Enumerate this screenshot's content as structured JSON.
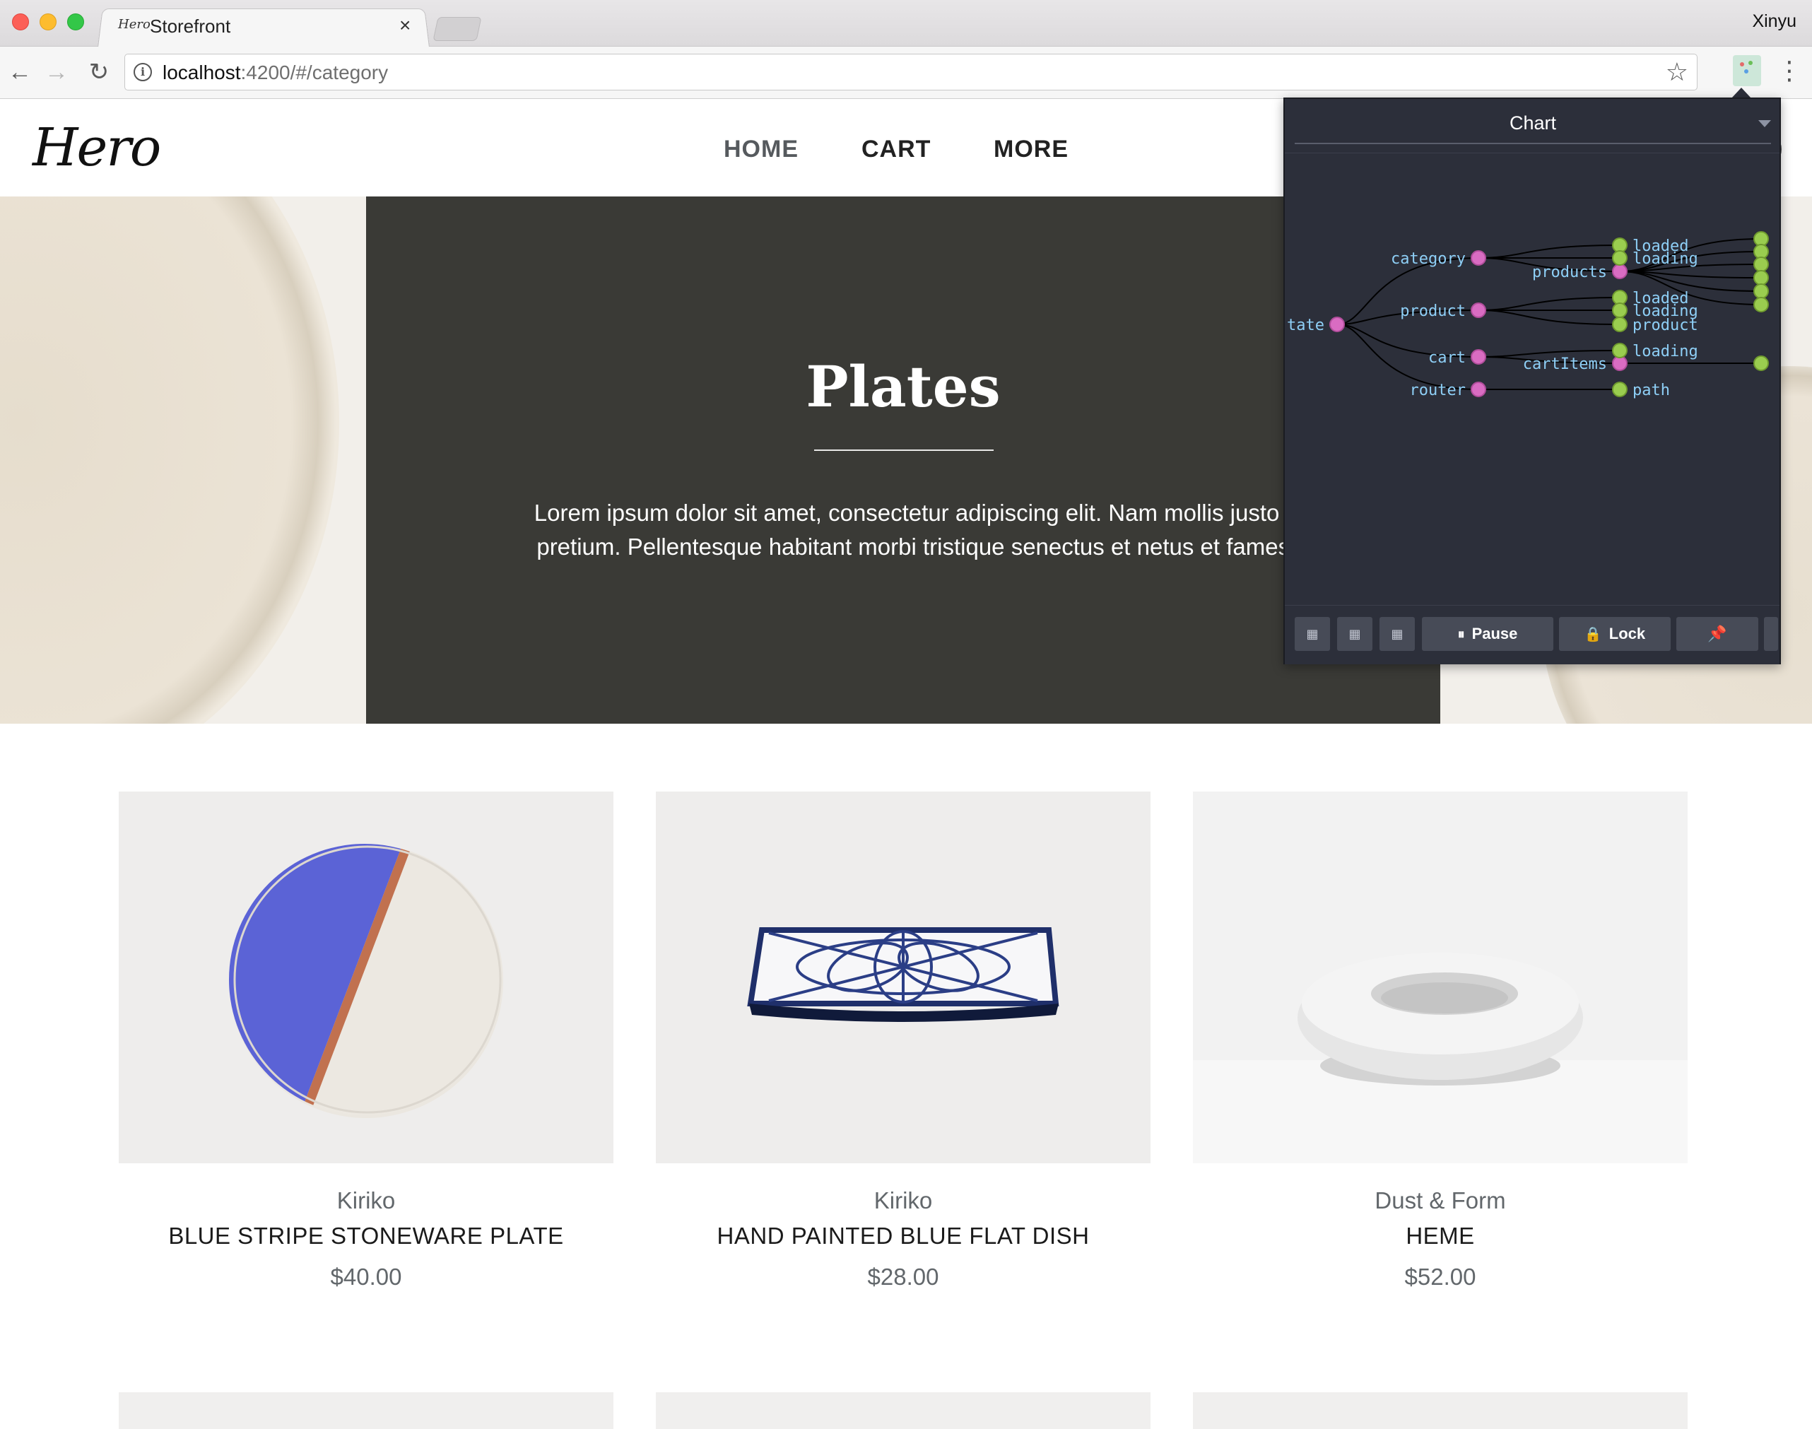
{
  "browser": {
    "tab_title": "Storefront",
    "tab_close_glyph": "×",
    "favicon_text": "Hero",
    "profile_name": "Xinyu",
    "url_host": "localhost",
    "url_path": ":4200/#/category",
    "icons": [
      "back-arrow-icon",
      "forward-arrow-icon",
      "reload-icon",
      "info-icon",
      "star-icon",
      "extension-icon",
      "more-vertical-icon"
    ]
  },
  "site": {
    "logo": "Hero",
    "nav": {
      "home": "HOME",
      "cart": "CART",
      "more": "MORE"
    },
    "header_edge_glyph": ")"
  },
  "hero": {
    "title": "Plates",
    "description_line1": "Lorem ipsum dolor sit amet, consectetur adipiscing elit. Nam mollis justo id cor",
    "description_line2": "pretium. Pellentesque habitant morbi tristique senectus et netus et fames ac e"
  },
  "products": [
    {
      "brand": "Kiriko",
      "name": "BLUE STRIPE STONEWARE PLATE",
      "price": "$40.00"
    },
    {
      "brand": "Kiriko",
      "name": "HAND PAINTED BLUE FLAT DISH",
      "price": "$28.00"
    },
    {
      "brand": "Dust & Form",
      "name": "HEME",
      "price": "$52.00"
    }
  ],
  "devtools": {
    "view_select": "Chart",
    "colors": {
      "branch_node": "#d96cc2",
      "leaf_node": "#9acd4f",
      "label": "#8ecff6",
      "panel_bg": "#2c2f3a"
    },
    "tree_labels": {
      "root": "tate",
      "category": "category",
      "category_loaded": "loaded",
      "category_loading": "loading",
      "products": "products",
      "product": "product",
      "product_loaded": "loaded",
      "product_loading": "loading",
      "product_product": "product",
      "cart": "cart",
      "cart_loading": "loading",
      "cart_items": "cartItems",
      "router": "router",
      "router_path": "path"
    },
    "toolbar": {
      "pause": "Pause",
      "lock": "Lock",
      "pin_icon": "pin-icon"
    }
  }
}
